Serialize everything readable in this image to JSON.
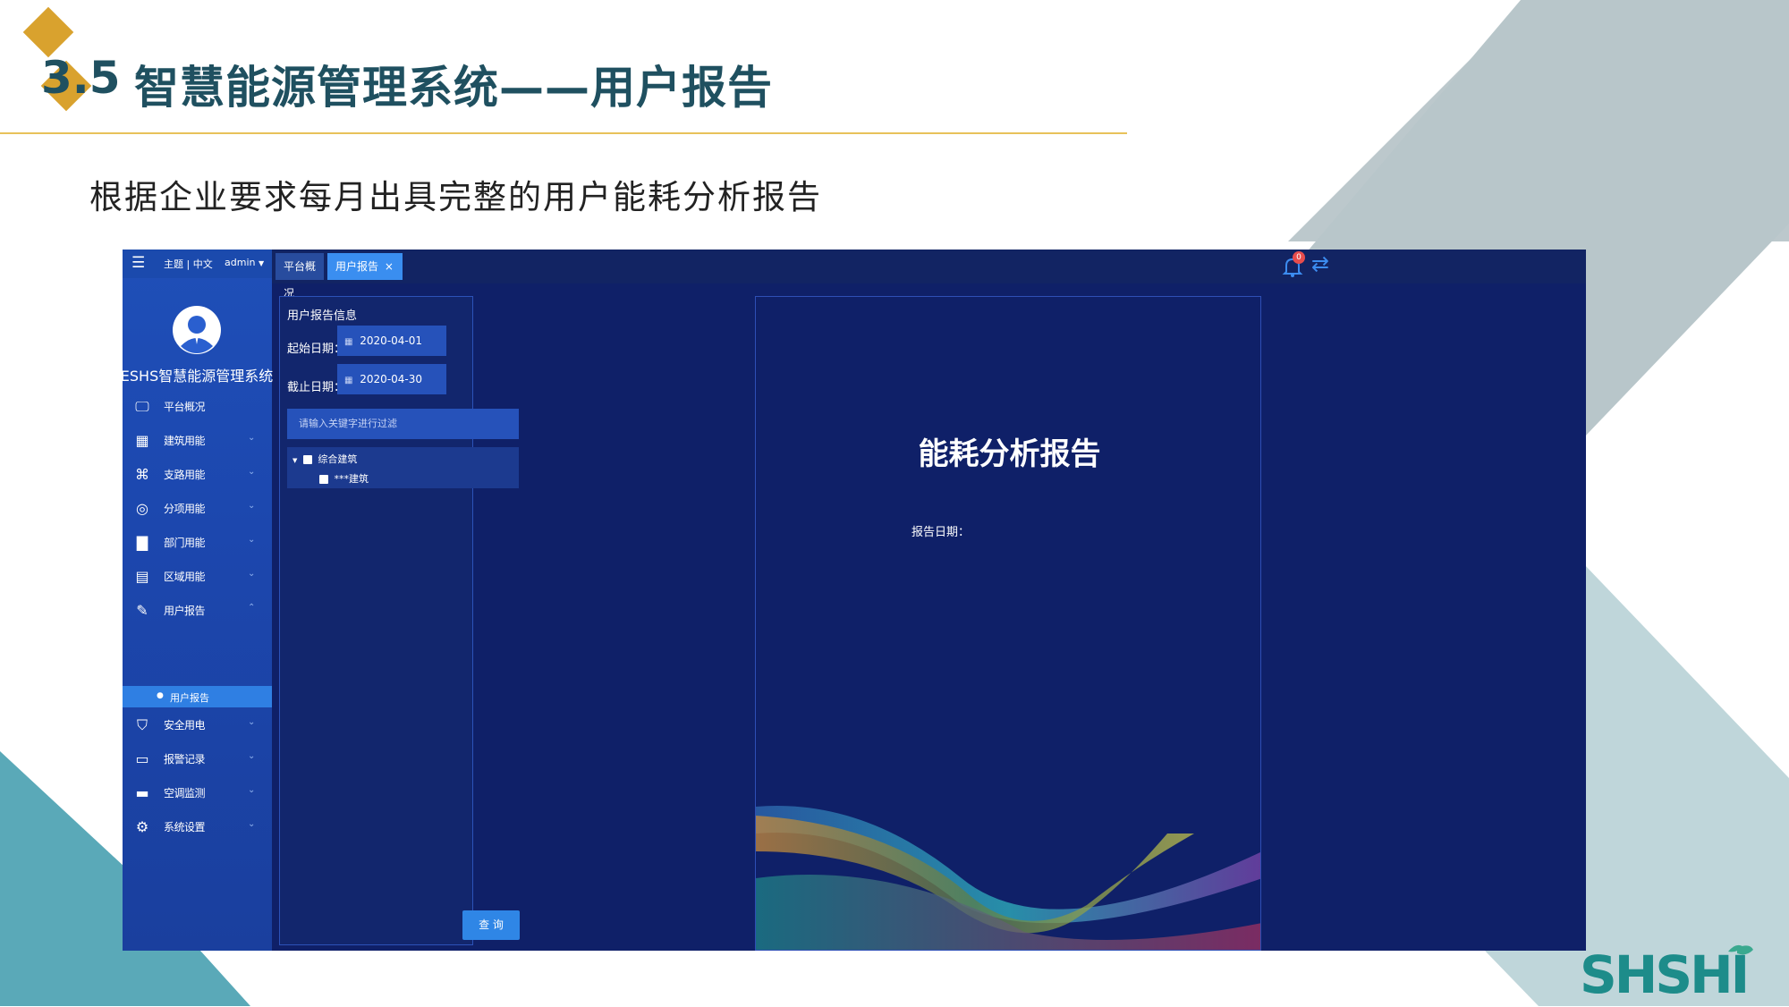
{
  "slide": {
    "section_number": "3.5",
    "title": "智慧能源管理系统——用户报告",
    "subtitle": "根据企业要求每月出具完整的用户能耗分析报告",
    "logo_text": "SHSHI",
    "colors": {
      "title": "#1f5060",
      "accent_gold": "#d9a22e",
      "rule": "#e8c25a",
      "logo": "#1d8c8a"
    }
  },
  "app": {
    "header": {
      "menu_icon": "hamburger-icon",
      "theme_lang": "主题 | 中文",
      "user": "admin"
    },
    "tabs": [
      {
        "label": "平台概况"
      },
      {
        "label": "用户报告",
        "close": "×"
      }
    ],
    "notification_count": "0",
    "profile": {
      "system_name": "ESHS智慧能源管理系统"
    },
    "menu": [
      {
        "label": "平台概况",
        "icon": "monitor-icon"
      },
      {
        "label": "建筑用能",
        "icon": "building-icon"
      },
      {
        "label": "支路用能",
        "icon": "network-icon"
      },
      {
        "label": "分项用能",
        "icon": "compass-icon"
      },
      {
        "label": "部门用能",
        "icon": "folder-icon"
      },
      {
        "label": "区域用能",
        "icon": "city-icon"
      },
      {
        "label": "用户报告",
        "icon": "edit-icon"
      },
      {
        "label": "安全用电",
        "icon": "shield-icon"
      },
      {
        "label": "报警记录",
        "icon": "document-icon"
      },
      {
        "label": "空调监测",
        "icon": "aircon-icon"
      },
      {
        "label": "系统设置",
        "icon": "settings-icon"
      }
    ],
    "submenu_active": "用户报告",
    "panel": {
      "title": "用户报告信息",
      "start_label": "起始日期：",
      "start_date": "2020-04-01",
      "end_label": "截止日期：",
      "end_date": "2020-04-30",
      "search_placeholder": "请输入关键字进行过滤",
      "tree": [
        {
          "label": "综合建筑"
        },
        {
          "label": "***建筑"
        }
      ],
      "query_button": "查 询"
    },
    "report": {
      "title": "能耗分析报告",
      "date_label": "报告日期："
    }
  }
}
